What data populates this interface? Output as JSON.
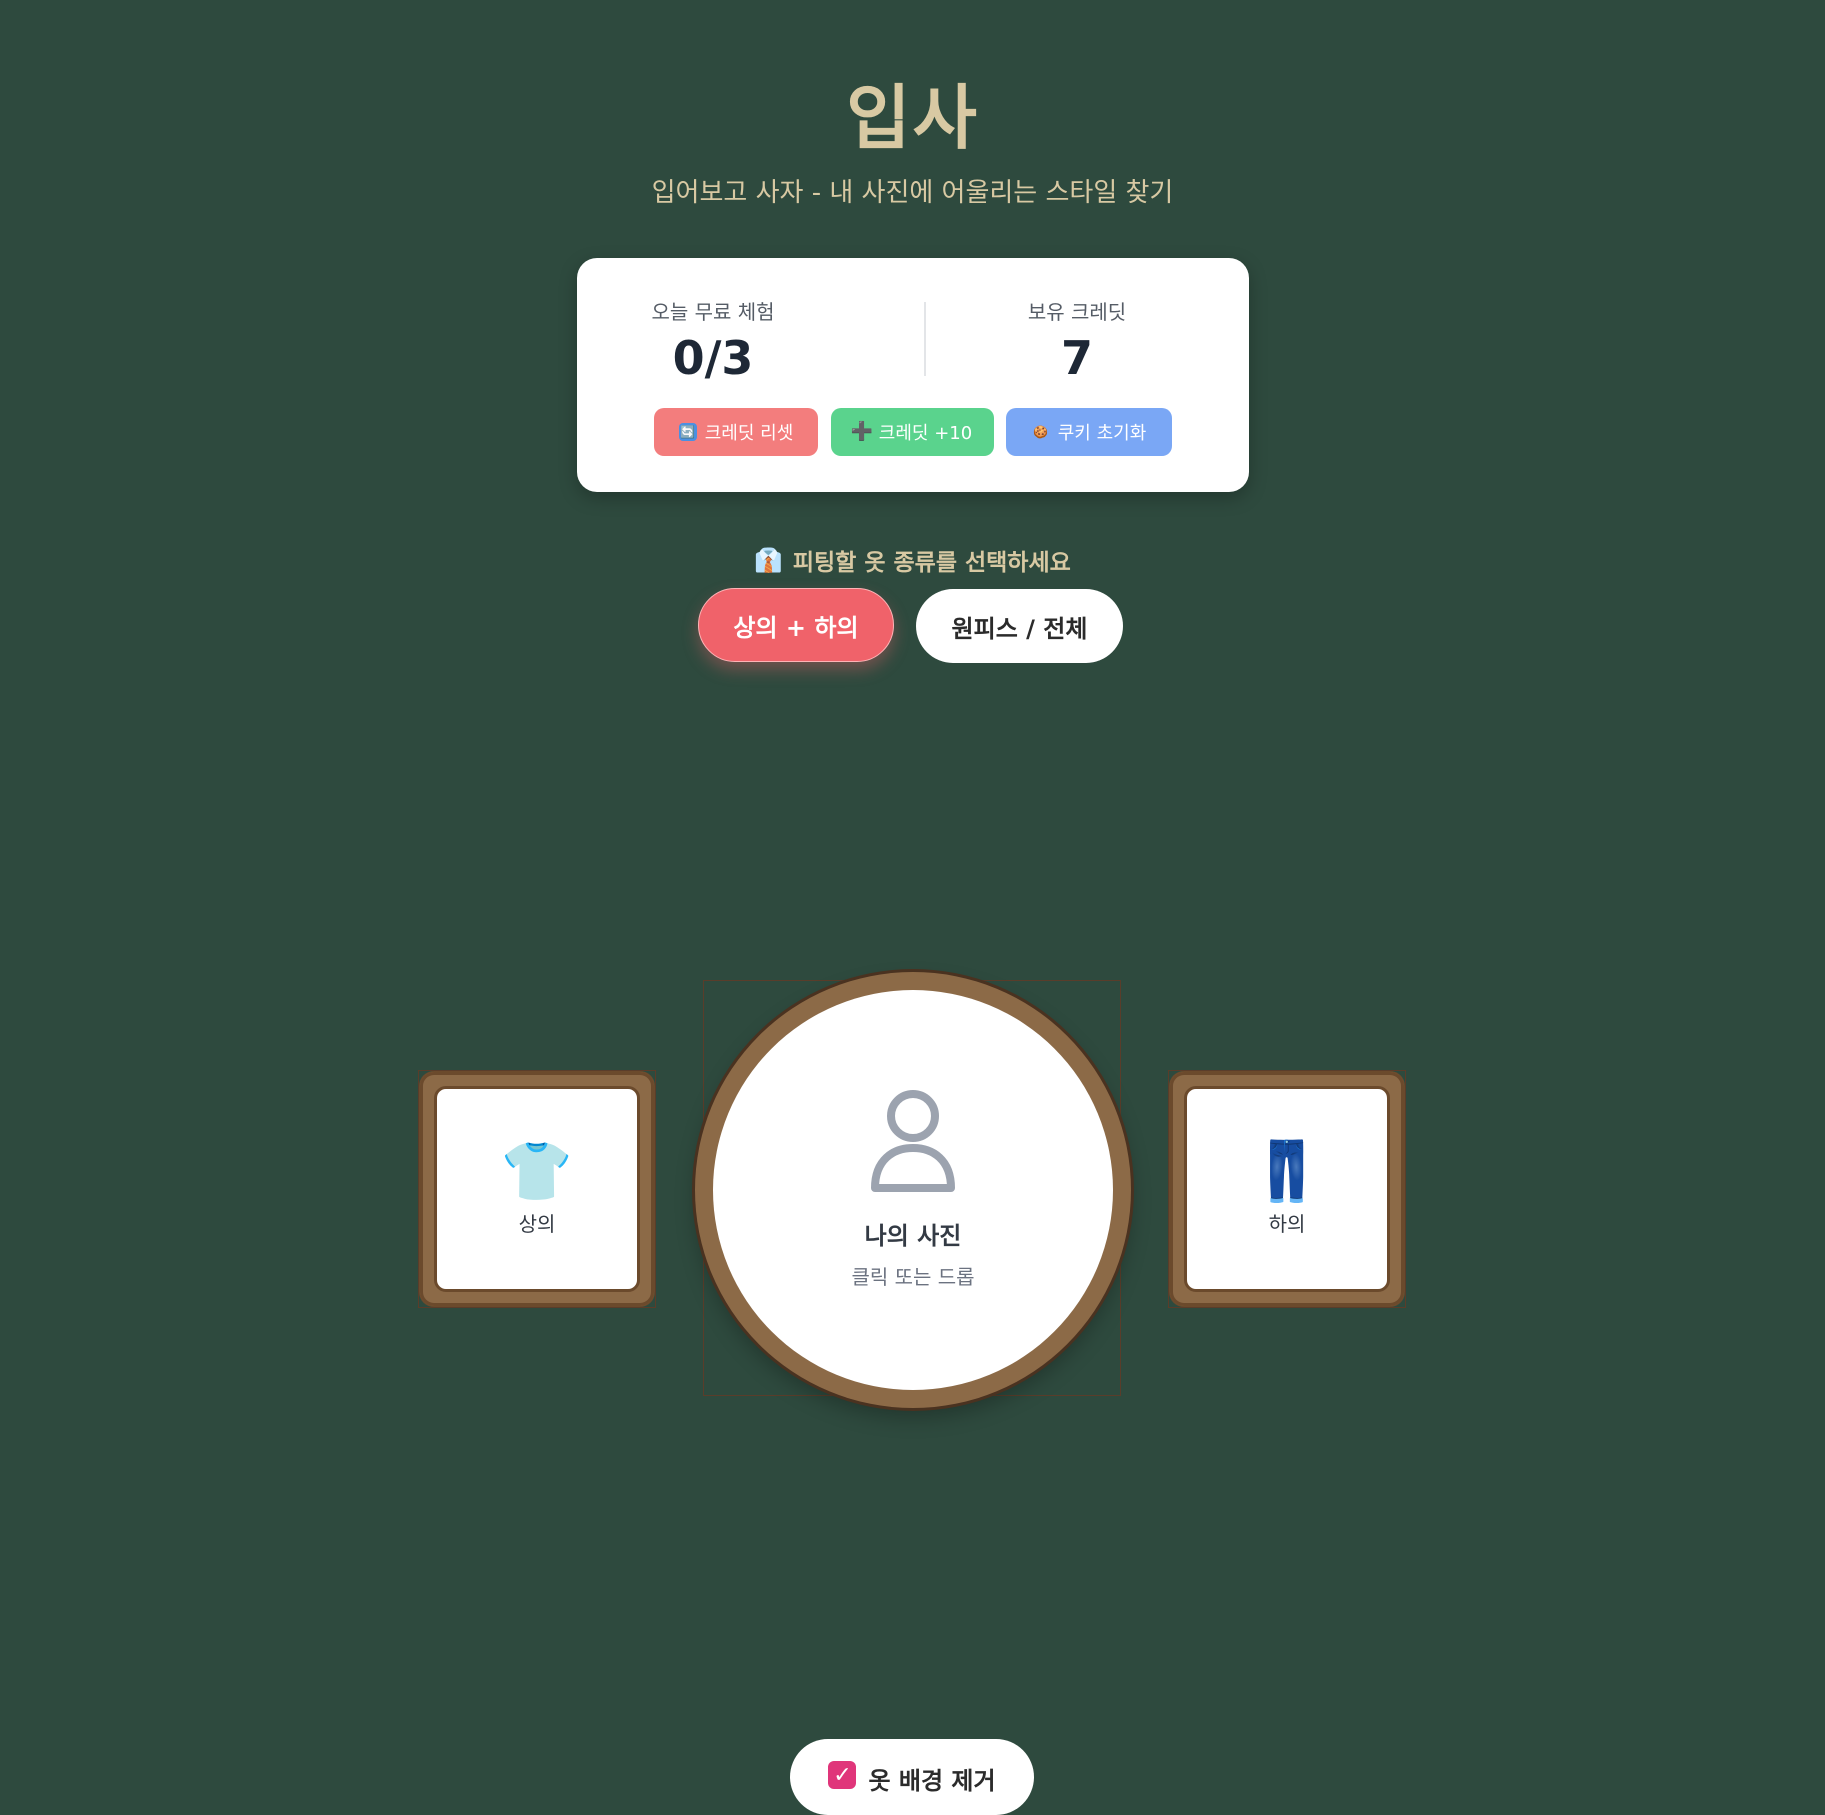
{
  "header": {
    "title": "입사",
    "subtitle": "입어보고 사자 - 내 사진에 어울리는 스타일 찾기"
  },
  "stats": {
    "free_trial_label": "오늘 무료 체험",
    "free_trial_value": "0/3",
    "credits_label": "보유 크레딧",
    "credits_value": "7"
  },
  "actions": {
    "reset_label": "크레딧 리셋",
    "add_label": "크레딧 +10",
    "cookie_label": "쿠키 초기화",
    "reset_icon": "🔄",
    "add_icon": "➕",
    "cookie_icon": "🍪",
    "reset_color": "#f37d7d",
    "add_color": "#5ad38d",
    "cookie_color": "#7aa7f5"
  },
  "clothing_type": {
    "prompt_icon": "👔",
    "prompt": "피팅할 옷 종류를 선택하세요",
    "options": [
      {
        "label": "상의 + 하의",
        "selected": true
      },
      {
        "label": "원피스 / 전체",
        "selected": false
      }
    ]
  },
  "slots": {
    "top": {
      "icon": "👕",
      "label": "상의"
    },
    "photo": {
      "title": "나의 사진",
      "hint": "클릭 또는 드롭"
    },
    "bottom": {
      "icon": "👖",
      "label": "하의"
    }
  },
  "options": {
    "remove_bg_checked": true,
    "remove_bg_label": "옷 배경 제거"
  }
}
